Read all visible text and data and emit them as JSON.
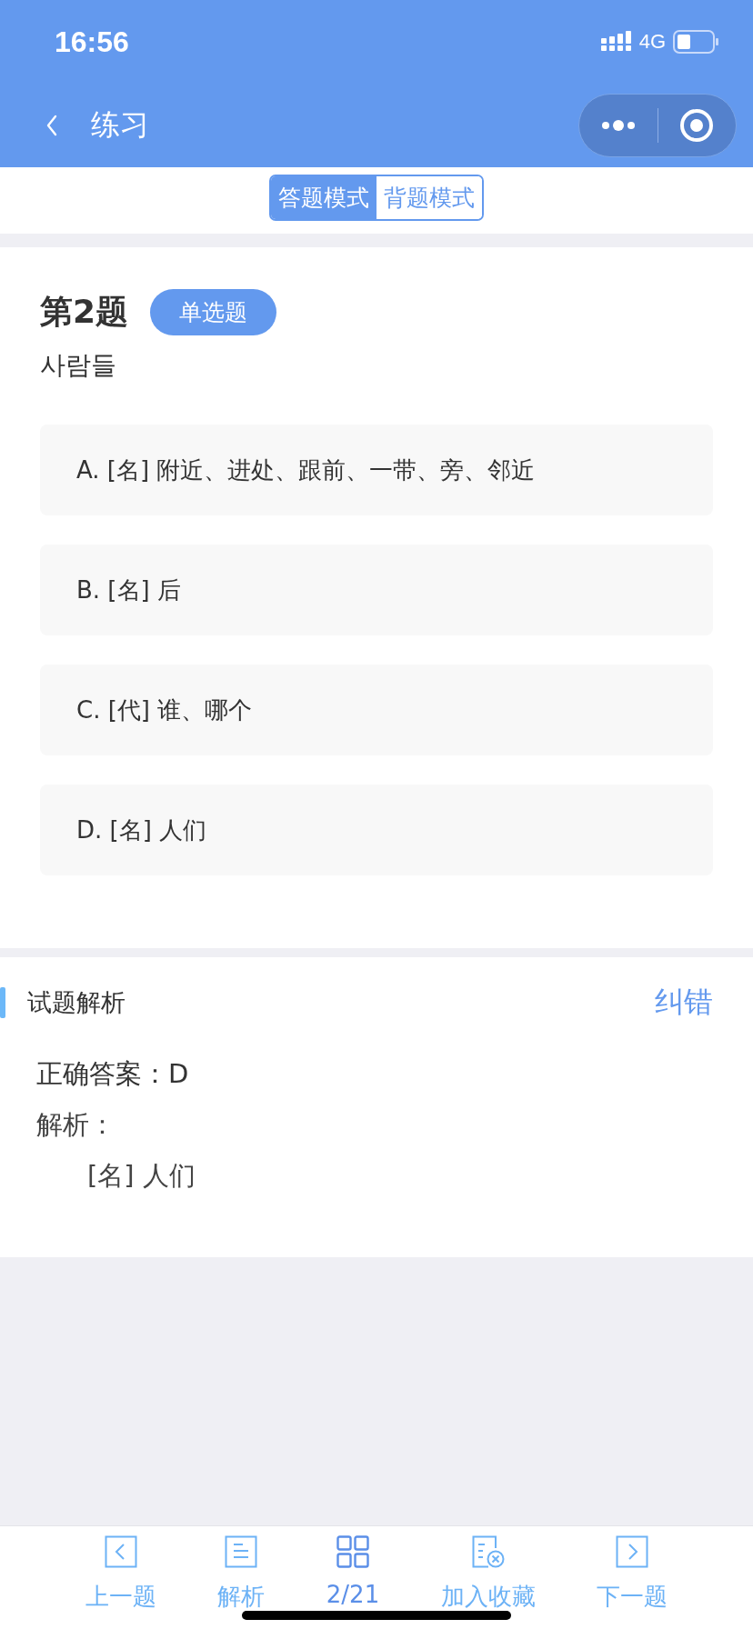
{
  "status_bar": {
    "time": "16:56",
    "network": "4G"
  },
  "nav": {
    "title": "练习"
  },
  "mode_tabs": [
    {
      "label": "答题模式",
      "selected": true
    },
    {
      "label": "背题模式",
      "selected": false
    }
  ],
  "question": {
    "number": "第2题",
    "type_badge": "单选题",
    "stem": "사람들",
    "options": [
      {
        "text": "A. [名] 附近、进处、跟前、一带、旁、邻近"
      },
      {
        "text": "B. [名] 后"
      },
      {
        "text": "C. [代] 谁、哪个"
      },
      {
        "text": "D. [名] 人们"
      }
    ]
  },
  "analysis": {
    "heading": "试题解析",
    "report_link": "纠错",
    "answer": "正确答案：D",
    "explanation_label": "解析：",
    "explanation": "[名] 人们"
  },
  "toolbar": [
    {
      "label": "上一题"
    },
    {
      "label": "解析"
    },
    {
      "label": "2/21"
    },
    {
      "label": "加入收藏"
    },
    {
      "label": "下一题"
    }
  ]
}
